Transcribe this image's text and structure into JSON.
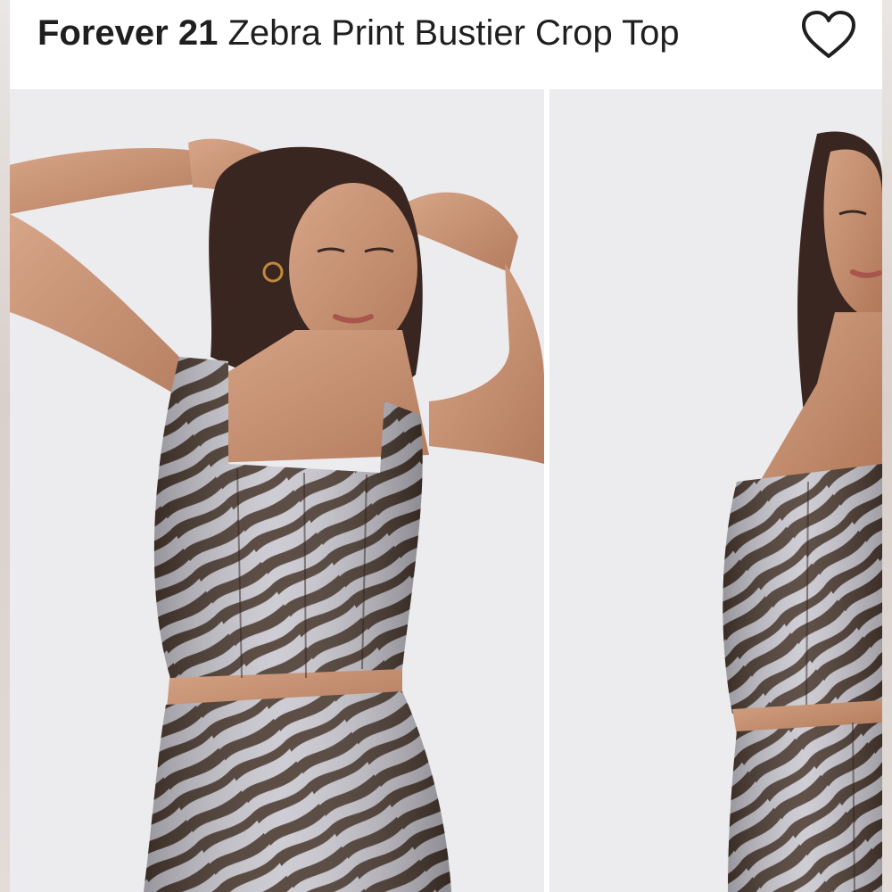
{
  "product": {
    "brand": "Forever 21",
    "title": "Zebra Print Bustier Crop Top"
  },
  "header": {
    "like_icon": "heart-outline-icon"
  },
  "gallery": {
    "photos": [
      {
        "subject": "model-front"
      },
      {
        "subject": "model-side"
      }
    ]
  },
  "colors": {
    "text": "#1f1f1f",
    "backdrop": "#ecebee",
    "print_dark": "#4a3a30",
    "print_light": "#c9c7cf"
  }
}
